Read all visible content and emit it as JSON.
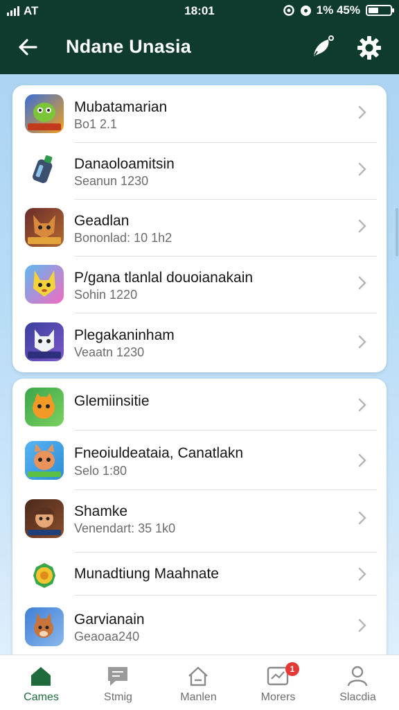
{
  "status_bar": {
    "carrier": "AT",
    "time": "18:01",
    "percent_text": "1% 45%",
    "battery_level": 0.45
  },
  "header": {
    "title": "Ndane Unasia"
  },
  "colors": {
    "header_bg": "#0e3b2e",
    "active_nav": "#1f6b3d",
    "badge": "#e53935"
  },
  "list_group_1": [
    {
      "name": "Mubatamarian",
      "subtitle": "Bo1 2.1",
      "icon": "green-monster-game-icon"
    },
    {
      "name": "Danaoloamitsin",
      "subtitle": "Seanun 1230",
      "icon": "lantern-game-icon"
    },
    {
      "name": "Geadlan",
      "subtitle": "Bononlad: 10 1h2",
      "icon": "fox-game-icon"
    },
    {
      "name": "P/gana tlanlal douoianakain",
      "subtitle": "Sohin 1220",
      "icon": "yellow-creature-game-icon"
    },
    {
      "name": "Plegakaninham",
      "subtitle": "Veaatn 1230",
      "icon": "white-cat-game-icon"
    }
  ],
  "list_group_2": [
    {
      "name": "Glemiinsitie",
      "subtitle": "",
      "icon": "orange-cat-game-icon"
    },
    {
      "name": "Fneoiuldeataia, Canatlakn",
      "subtitle": "Selo 1:80",
      "icon": "kangaroo-game-icon"
    },
    {
      "name": "Shamke",
      "subtitle": "Venendart: 35 1k0",
      "icon": "warrior-game-icon"
    },
    {
      "name": "Munadtiung Maahnate",
      "subtitle": "",
      "icon": "medal-game-icon"
    },
    {
      "name": "Garvianain",
      "subtitle": "Geaoaa240",
      "icon": "squirrel-game-icon"
    }
  ],
  "bottom_nav": [
    {
      "label": "Cames",
      "icon": "home-icon",
      "active": true
    },
    {
      "label": "Stmig",
      "icon": "chat-icon",
      "active": false
    },
    {
      "label": "Manlen",
      "icon": "house-outline-icon",
      "active": false
    },
    {
      "label": "Morers",
      "icon": "inbox-icon",
      "active": false,
      "badge": "1"
    },
    {
      "label": "Slacdia",
      "icon": "profile-icon",
      "active": false
    }
  ]
}
